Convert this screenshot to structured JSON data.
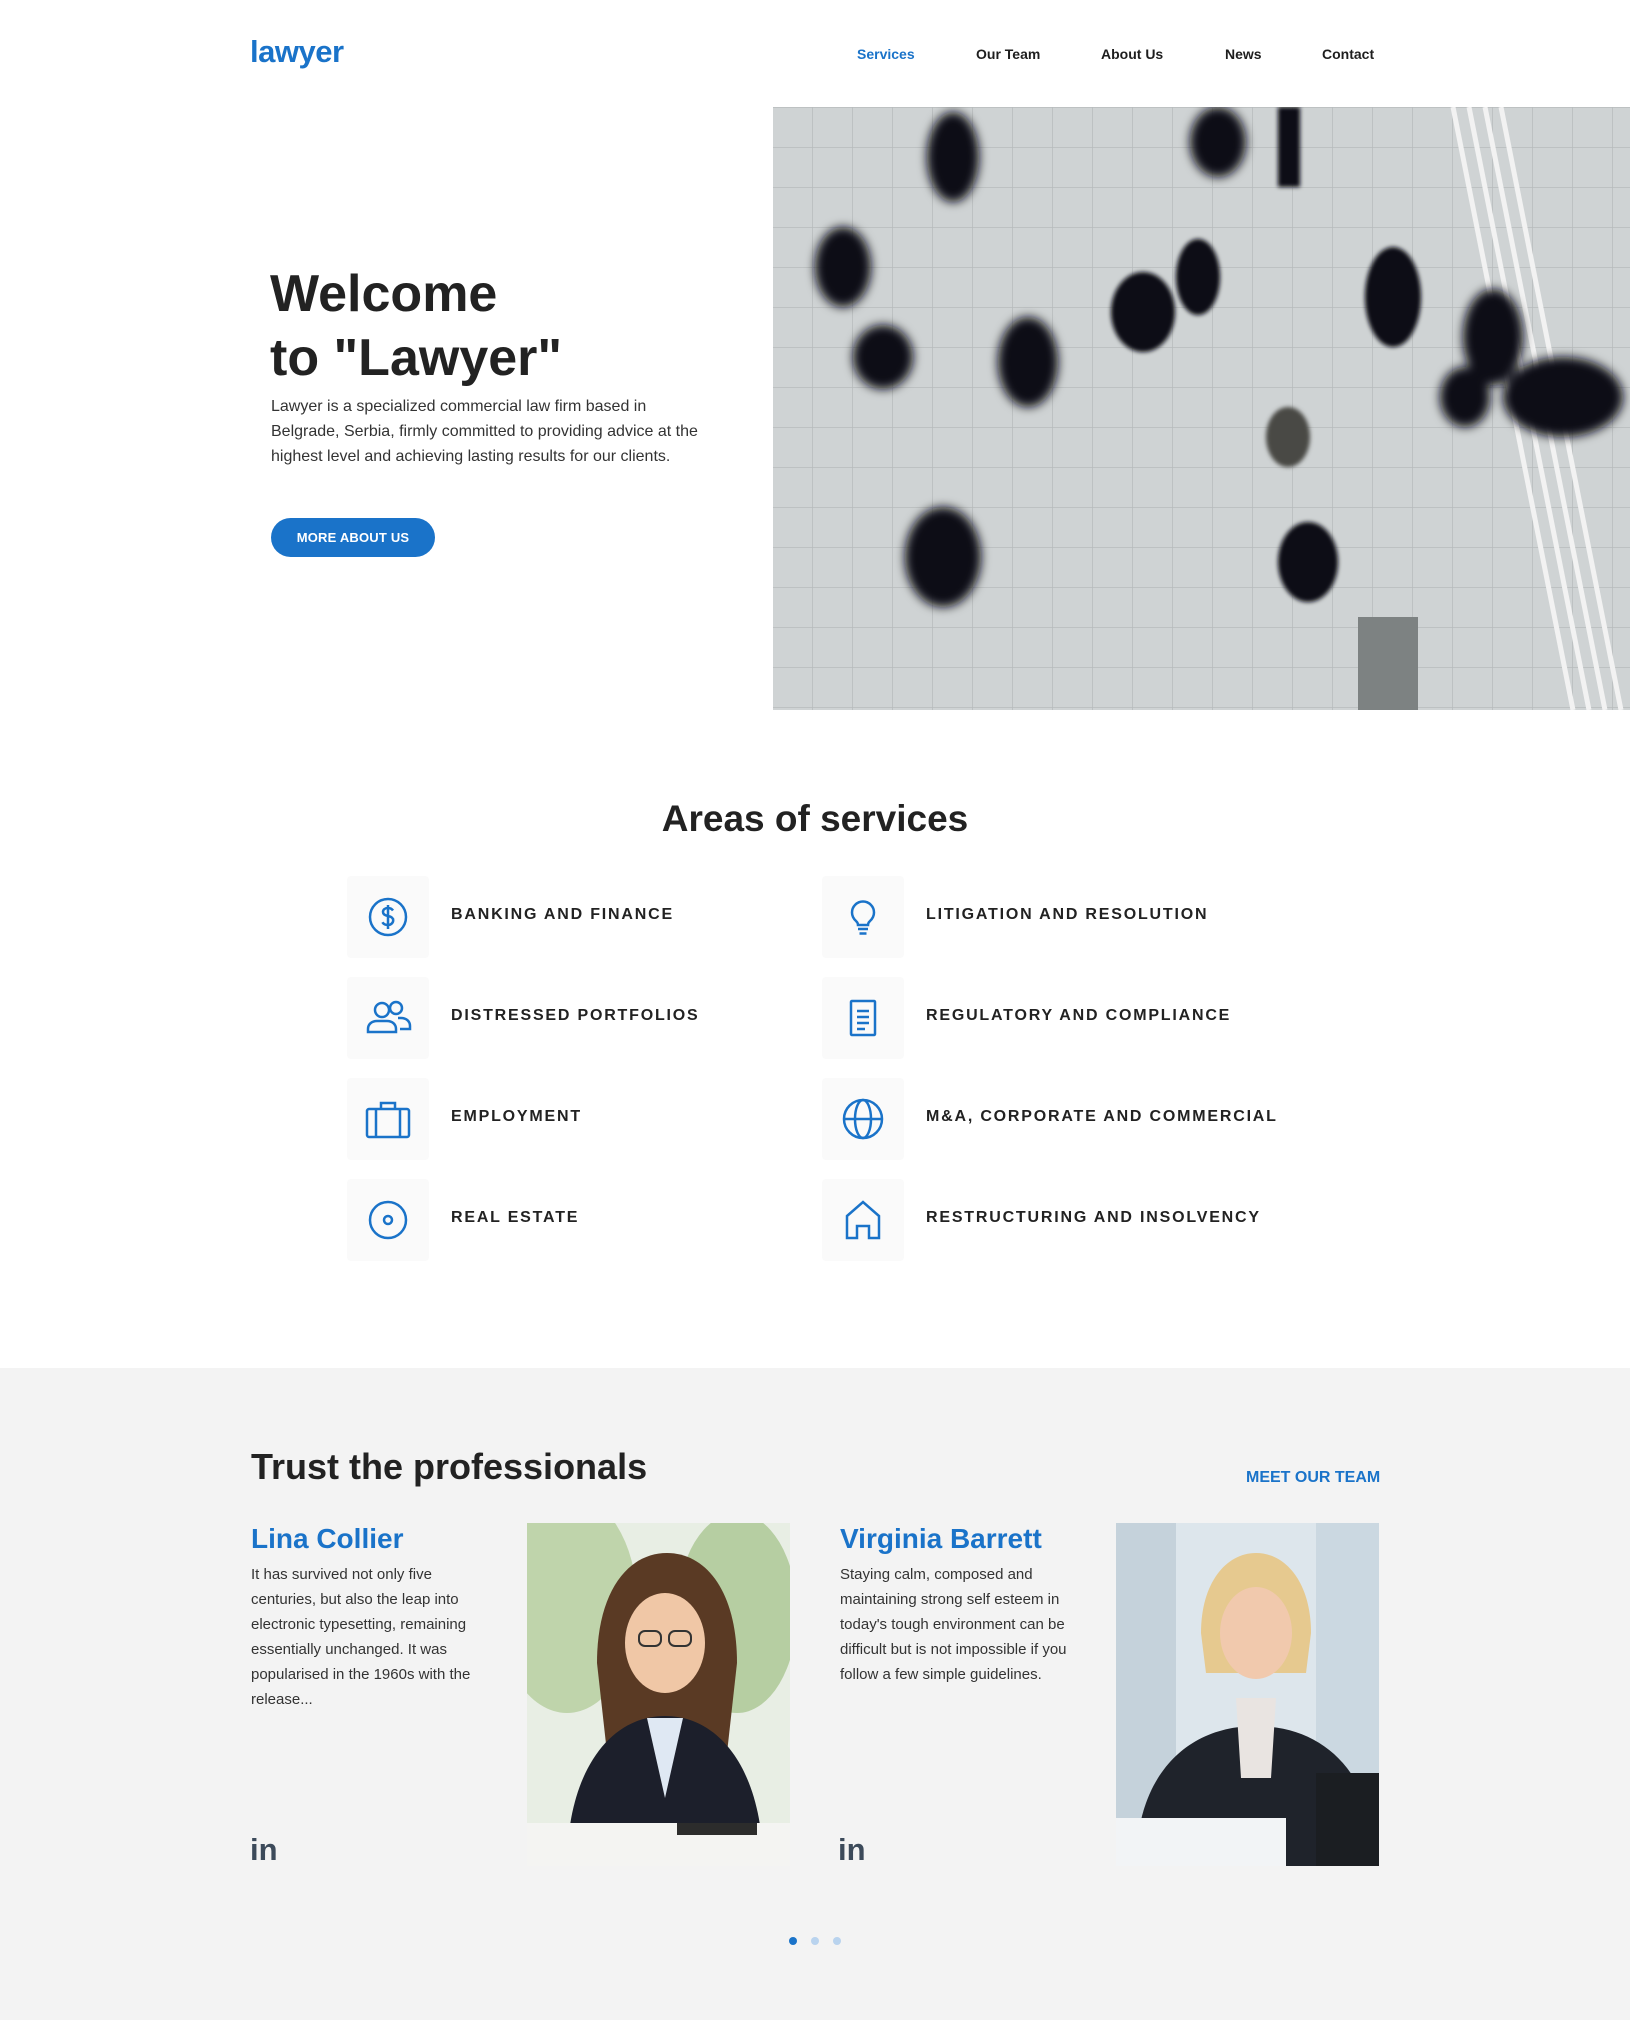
{
  "header": {
    "logo": "lawyer",
    "nav": [
      {
        "label": "Services",
        "active": true
      },
      {
        "label": "Our Team",
        "active": false
      },
      {
        "label": "About Us",
        "active": false
      },
      {
        "label": "News",
        "active": false
      },
      {
        "label": "Contact",
        "active": false
      }
    ]
  },
  "hero": {
    "title_line1": "Welcome",
    "title_line2": "to \"Lawyer\"",
    "text": "Lawyer is a specialized commercial law firm based in Belgrade, Serbia, firmly committed to providing advice at the highest level and achieving lasting results for our clients.",
    "button": "MORE ABOUT US"
  },
  "services": {
    "title": "Areas of services",
    "items": [
      {
        "label": "BANKING AND FINANCE",
        "icon": "dollar-icon"
      },
      {
        "label": "LITIGATION AND RESOLUTION",
        "icon": "lightbulb-icon"
      },
      {
        "label": "DISTRESSED PORTFOLIOS",
        "icon": "users-icon"
      },
      {
        "label": "REGULATORY AND COMPLIANCE",
        "icon": "document-icon"
      },
      {
        "label": "EMPLOYMENT",
        "icon": "briefcase-icon"
      },
      {
        "label": "M&A, CORPORATE AND COMMERCIAL",
        "icon": "globe-icon"
      },
      {
        "label": "REAL ESTATE",
        "icon": "target-icon"
      },
      {
        "label": "RESTRUCTURING AND INSOLVENCY",
        "icon": "home-icon"
      }
    ]
  },
  "team": {
    "title": "Trust the professionals",
    "link": "MEET OUR TEAM",
    "members": [
      {
        "name": "Lina Collier",
        "bio": "It has survived not only five centuries, but also the leap into electronic typesetting, remaining essentially unchanged. It was popularised in the 1960s with the release...",
        "social": "in"
      },
      {
        "name": "Virginia Barrett",
        "bio": "Staying calm, composed and maintaining strong self esteem in today's tough environment can be difficult but is not impossible if you follow a few simple guidelines.",
        "social": "in"
      }
    ],
    "carousel": {
      "pages": 3,
      "active": 1
    }
  },
  "colors": {
    "accent": "#1a73c9",
    "team_bg": "#f3f3f3",
    "text": "#222222"
  }
}
